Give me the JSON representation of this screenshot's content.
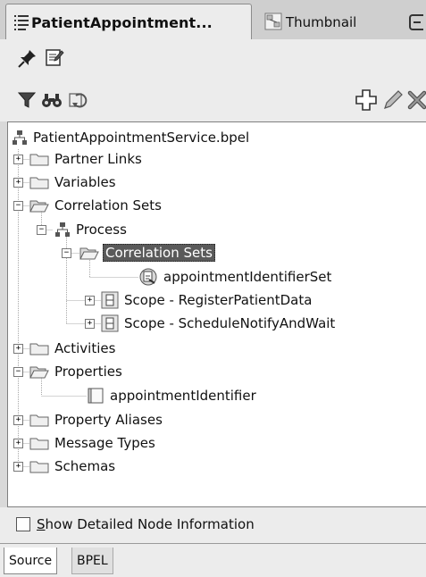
{
  "tabs": {
    "active_label": "PatientAppointment...",
    "inactive_label": "Thumbnail"
  },
  "toolbar": {
    "row1_icons": [
      "pin-icon",
      "edit-icon"
    ],
    "filter_icons": [
      "filter-icon",
      "find-icon",
      "refresh-icon"
    ],
    "action_icons": [
      "add-icon",
      "pencil-icon",
      "delete-icon"
    ]
  },
  "tree": {
    "root": "PatientAppointmentService.bpel",
    "partner_links": "Partner Links",
    "variables": "Variables",
    "correlation_sets": "Correlation Sets",
    "process": "Process",
    "process_correlation_sets": "Correlation Sets",
    "appointment_identifier_set": "appointmentIdentifierSet",
    "scope_register": "Scope - RegisterPatientData",
    "scope_schedule": "Scope - ScheduleNotifyAndWait",
    "activities": "Activities",
    "properties": "Properties",
    "appointment_identifier": "appointmentIdentifier",
    "property_aliases": "Property Aliases",
    "message_types": "Message Types",
    "schemas": "Schemas"
  },
  "options": {
    "show_detailed_first": "S",
    "show_detailed_rest": "how Detailed Node Information",
    "show_detailed_checked": false
  },
  "bottom_tabs": {
    "source": "Source",
    "bpel": "BPEL"
  }
}
